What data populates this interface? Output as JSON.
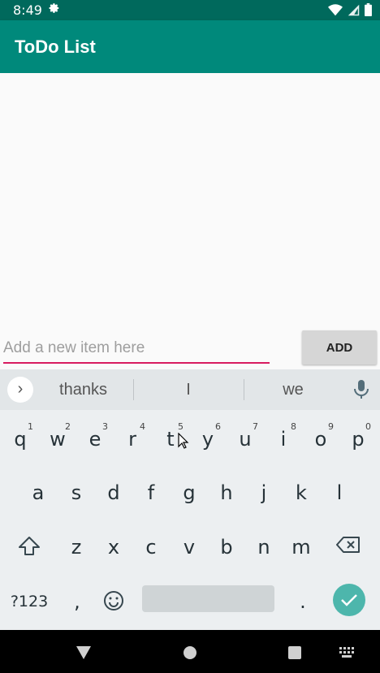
{
  "status_bar": {
    "time": "8:49",
    "settings_icon": "gear-icon",
    "icons": [
      "wifi-icon",
      "cell-signal-icon",
      "battery-icon"
    ]
  },
  "app_bar": {
    "title": "ToDo List"
  },
  "new_item": {
    "value": "",
    "placeholder": "Add a new item here",
    "add_label": "ADD"
  },
  "keyboard": {
    "suggestions": [
      "thanks",
      "I",
      "we"
    ],
    "row1": [
      {
        "key": "q",
        "hint": "1"
      },
      {
        "key": "w",
        "hint": "2"
      },
      {
        "key": "e",
        "hint": "3"
      },
      {
        "key": "r",
        "hint": "4"
      },
      {
        "key": "t",
        "hint": "5"
      },
      {
        "key": "y",
        "hint": "6"
      },
      {
        "key": "u",
        "hint": "7"
      },
      {
        "key": "i",
        "hint": "8"
      },
      {
        "key": "o",
        "hint": "9"
      },
      {
        "key": "p",
        "hint": "0"
      }
    ],
    "row2": [
      "a",
      "s",
      "d",
      "f",
      "g",
      "h",
      "j",
      "k",
      "l"
    ],
    "row3": [
      "z",
      "x",
      "c",
      "v",
      "b",
      "n",
      "m"
    ],
    "symbols_label": "?123",
    "comma": ",",
    "period": "."
  },
  "colors": {
    "app_bar": "#00897b",
    "status_bar": "#00695c",
    "input_underline": "#d81b60",
    "enter_key": "#4db6ac"
  }
}
